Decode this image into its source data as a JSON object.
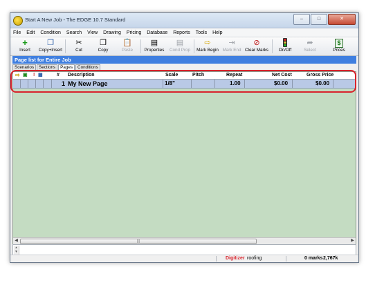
{
  "window": {
    "title": "Start A New Job - The EDGE 10.7 Standard"
  },
  "menu": [
    "File",
    "Edit",
    "Condition",
    "Search",
    "View",
    "Drawing",
    "Pricing",
    "Database",
    "Reports",
    "Tools",
    "Help"
  ],
  "toolbar": {
    "insert": "Insert",
    "copy_insert": "Copy+Insert",
    "cut": "Cut",
    "copy": "Copy",
    "paste": "Paste",
    "properties": "Properties",
    "cond_prop": "Cond Prop",
    "mark_begin": "Mark Begin",
    "mark_end": "Mark End",
    "clear_marks": "Clear Marks",
    "on_off": "On/Off",
    "select": "Select",
    "prices": "Prices"
  },
  "panel_title": "Page list for Entire Job",
  "tabs": [
    "Scenarios",
    "Sections",
    "Pages",
    "Conditions"
  ],
  "active_tab": "Pages",
  "grid": {
    "columns": {
      "number": "#",
      "description": "Description",
      "scale": "Scale",
      "pitch": "Pitch",
      "repeat": "Repeat",
      "net_cost": "Net Cost",
      "gross_price": "Gross Price"
    },
    "rows": [
      {
        "number": "1",
        "description": "My New Page",
        "scale": "1/8\"",
        "pitch": "",
        "repeat": "1.00",
        "net_cost": "$0.00",
        "gross_price": "$0.00"
      }
    ]
  },
  "status": {
    "digitizer": "Digitizer",
    "condition": "roofing",
    "marks": "0 marks",
    "memory": "2,767k"
  },
  "colors": {
    "panel_header": "#3f7fe0",
    "grid_background": "#c4dcc2",
    "selected_row": "#b9c9e6",
    "highlight": "#d9232c",
    "digitizer": "#d9232c"
  }
}
